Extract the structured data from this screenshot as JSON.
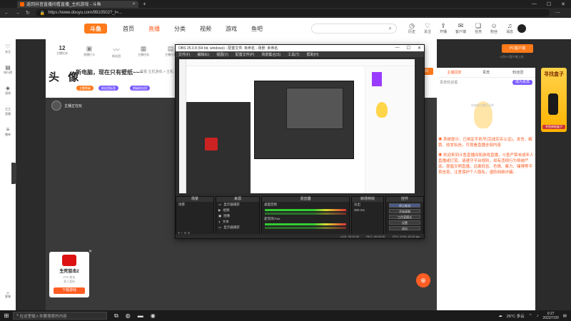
{
  "browser": {
    "tab_title": "返回抖音直播间看直播_主机游戏 - 斗鱼",
    "url": "https://www.douyu.com/9910502?_t=...",
    "controls": [
      "—",
      "☐",
      "✕"
    ]
  },
  "header": {
    "logo": "斗鱼",
    "nav": [
      "首页",
      "直播",
      "分类",
      "视频",
      "游戏",
      "鱼吧"
    ],
    "active_nav": "直播",
    "search_placeholder": "",
    "icons": [
      {
        "icon": "clock-icon",
        "label": "历史"
      },
      {
        "icon": "follow-icon",
        "label": "关注"
      },
      {
        "icon": "upload-icon",
        "label": "开播"
      },
      {
        "icon": "mail-icon",
        "label": "客户端"
      },
      {
        "icon": "gift-icon",
        "label": "任务"
      },
      {
        "icon": "user-icon",
        "label": "粉丝"
      },
      {
        "icon": "bell-icon",
        "label": "消息"
      }
    ]
  },
  "left_sidebar": {
    "items": [
      "关注",
      "排行榜",
      "游戏",
      "直播",
      "播单"
    ],
    "bottom": "客服"
  },
  "room": {
    "tasks": [
      {
        "value": "12",
        "label": "主播任务"
      },
      {
        "value": "",
        "label": "直播打卡"
      },
      {
        "value": "",
        "label": "粉丝团"
      },
      {
        "value": "",
        "label": "主播任务"
      },
      {
        "value": "",
        "label": "主播任务"
      },
      {
        "value": "",
        "label": "火力全开"
      }
    ],
    "anchor_name": "头 像",
    "title": "新电脑，现在只有壁纸~~~",
    "subtitle": "举报  主机游戏 > 主机",
    "pills": [
      "主播等级",
      "粉丝团标签",
      "超级粉丝团"
    ],
    "subscribe": "订阅",
    "streamer_badge": "主播正在玩"
  },
  "obs": {
    "title": "OBS 25.0.8 (64 bit, windows) - 配置文件: 未命名 - 场景: 未命名",
    "menu": [
      "文件(F)",
      "编辑(E)",
      "视图(V)",
      "配置文件(P)",
      "场景集合(S)",
      "工具(T)",
      "帮助(H)"
    ],
    "docks": {
      "scenes": "场景",
      "sources": "来源",
      "mixer": "混音器",
      "transitions": "转场特效",
      "controls": "控件"
    },
    "scenes_items": [
      "场景"
    ],
    "source_items": [
      "显示器捕获",
      "视频",
      "图像",
      "文本",
      "显示器捕获"
    ],
    "mixer_items": [
      "桌面音频",
      "麦克风/Aux"
    ],
    "transition": "淡出",
    "transition_duration": "300 ms",
    "control_buttons": [
      "停止推流",
      "开始录制",
      "工作室模式",
      "设置",
      "退出"
    ],
    "status": [
      "LIVE: 00:00:00",
      "REC: 00:00:00",
      "CPU: 3.0%, 60.00 fps"
    ]
  },
  "right_panel": {
    "tabs": [
      "主播回复",
      "贵宾",
      "粉丝团"
    ],
    "active_tab": "主播回复",
    "row2_text": "贵宾欢迎语",
    "row2_button": "成为贵宾",
    "empty_text": "快来和主播互动吧",
    "pc_client": "PC客户端",
    "pc_sub": "斗鱼PC客户端上线",
    "sys_msg": "系统提示：已绑定手机号(完成实名认证)，发言、解锁、收发私信，可观看直播全部内容",
    "notice": "欢迎来到斗鱼直播间和游戏直播，斗鱼严禁未成年人直播或打赏。请遵守平台规则，如有违规行为将被严惩。提倡文明直播，远离低俗、色情、暴力、赌博等不良信息，注意保护个人隐私，谨防网络诈骗。"
  },
  "promo": {
    "title": "寻找盒子",
    "footer": "寻找神秘盒子"
  },
  "game_card": {
    "name": "生死狙击2",
    "meta": "FPS  射击",
    "meta2": "多人竞技",
    "button": "下载游戏"
  },
  "taskbar": {
    "search": "在这里输入你要搜索的内容",
    "weather": "26°C 多云",
    "time": "0:27",
    "date": "2022/7/20"
  }
}
